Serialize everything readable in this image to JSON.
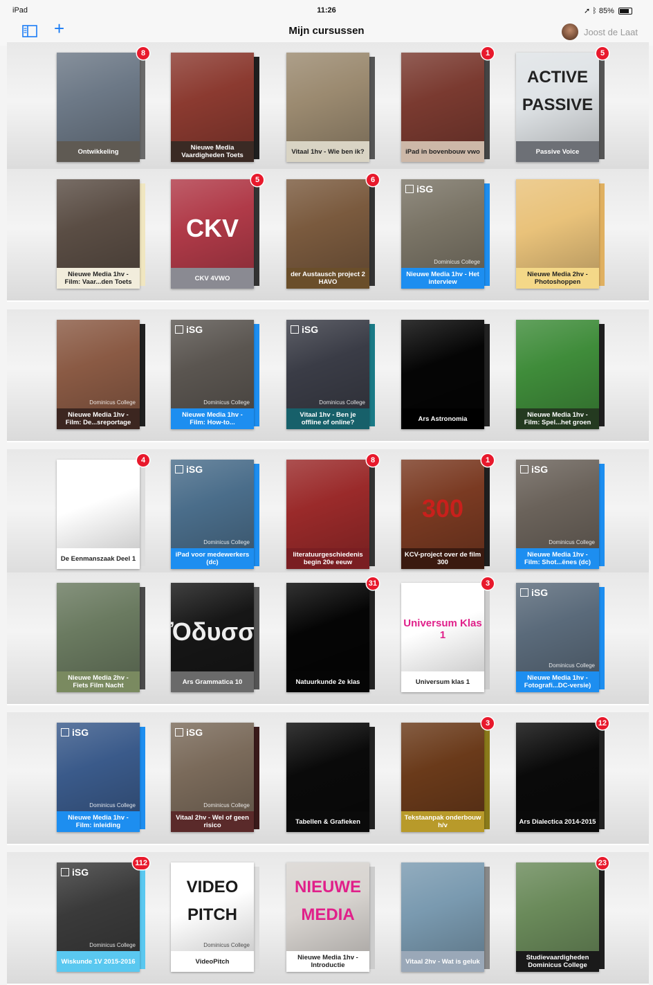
{
  "status": {
    "device": "iPad",
    "time": "11:26",
    "battery": "85%"
  },
  "nav": {
    "title": "Mijn cursussen",
    "user": "Joost de Laat"
  },
  "courses": [
    {
      "label": "Ontwikkeling",
      "badge": "8",
      "cover": "#6c7886",
      "band": "#5f5a53",
      "spine": "#6a6a6a"
    },
    {
      "label": "Nieuwe Media Vaardigheden Toets",
      "badge": "",
      "cover": "#8b3a30",
      "band": "#3a2a24",
      "spine": "#1f1f1f"
    },
    {
      "label": "Vitaal 1hv - Wie ben ik?",
      "badge": "",
      "cover": "#9b8a70",
      "band": "#d9d4c4",
      "spine": "#555555",
      "dark": true
    },
    {
      "label": "iPad in bovenbouw vwo",
      "badge": "1",
      "cover": "#7a3a30",
      "band": "#cdb8a8",
      "spine": "#444444",
      "dark": true
    },
    {
      "label": "Passive Voice",
      "badge": "5",
      "cover": "#dfe3e6",
      "band": "#6d7076",
      "spine": "#555555",
      "big": "ACTIVE|PASSIVE",
      "bigc": "#222"
    },
    {
      "label": "Nieuwe Media 1hv - Film: Vaar...den Toets",
      "badge": "",
      "cover": "#5a4d44",
      "band": "#f2eddc",
      "spine": "#f0e6c0",
      "dark": true
    },
    {
      "label": "CKV 4VWO",
      "badge": "5",
      "cover": "#b03a48",
      "band": "#8a8a92",
      "spine": "#333333",
      "big": "CKV",
      "bigc": "#fff"
    },
    {
      "label": "der Austausch project 2 HAVO",
      "badge": "6",
      "cover": "#7a5a3e",
      "band": "#6a4e2a",
      "spine": "#333333"
    },
    {
      "label": "Nieuwe Media 1hv - Het interview",
      "badge": "",
      "cover": "#7a7466",
      "band": "#1d8ef0",
      "spine": "#1d8ef0",
      "isg": "iSG",
      "school": "Dominicus College"
    },
    {
      "label": "Nieuwe Media 2hv - Photoshoppen",
      "badge": "",
      "cover": "#e9c27a",
      "band": "#f4d888",
      "spine": "#e0b060",
      "dark": true
    },
    {
      "label": "Nieuwe Media 1hv - Film: De...sreportage",
      "badge": "",
      "cover": "#8a5a44",
      "band": "#3c2620",
      "spine": "#1f1f1f",
      "school": "Dominicus College"
    },
    {
      "label": "Nieuwe Media 1hv - Film: How-to...",
      "badge": "",
      "cover": "#5a5550",
      "band": "#1d8ef0",
      "spine": "#1d8ef0",
      "isg": "iSG",
      "school": "Dominicus College"
    },
    {
      "label": "Vitaal 1hv - Ben je offline of online?",
      "badge": "",
      "cover": "#3a3c46",
      "band": "#17606a",
      "spine": "#1a7a86",
      "isg": "iSG",
      "school": "Dominicus College"
    },
    {
      "label": "Ars Astronomia",
      "badge": "",
      "cover": "#050505",
      "band": "#000000",
      "spine": "#222222"
    },
    {
      "label": "Nieuwe Media 1hv - Film: Spel...het groen",
      "badge": "",
      "cover": "#3f8c3a",
      "band": "#243a20",
      "spine": "#1f1f1f"
    },
    {
      "label": "De Eenmanszaak Deel 1",
      "badge": "4",
      "cover": "#ffffff",
      "band": "#ffffff",
      "spine": "#dddddd",
      "dark": true
    },
    {
      "label": "iPad voor medewerkers (dc)",
      "badge": "",
      "cover": "#4a6d8a",
      "band": "#1d8ef0",
      "spine": "#1d8ef0",
      "isg": "iSG",
      "school": "Dominicus College"
    },
    {
      "label": "literatuurgeschiedenis begin 20e eeuw",
      "badge": "8",
      "cover": "#9a2a2a",
      "band": "#7a1e22",
      "spine": "#333333"
    },
    {
      "label": "KCV-project over de film 300",
      "badge": "1",
      "cover": "#7a3a22",
      "band": "#3a1a10",
      "spine": "#1f1f1f",
      "big": "300",
      "bigc": "#c8201c"
    },
    {
      "label": "Nieuwe Media 1hv - Film: Shot...ënes (dc)",
      "badge": "",
      "cover": "#6a625a",
      "band": "#1d8ef0",
      "spine": "#1d8ef0",
      "isg": "iSG",
      "school": "Dominicus College"
    },
    {
      "label": "Nieuwe Media 2hv - Fiets Film Nacht",
      "badge": "",
      "cover": "#6a7a60",
      "band": "#7a8a60",
      "spine": "#4a4a4a"
    },
    {
      "label": "Ars Grammatica 10",
      "badge": "",
      "cover": "#161616",
      "band": "#6a6a6a",
      "spine": "#555555",
      "big": "Ὀδυσσεῦ",
      "bigc": "#eee"
    },
    {
      "label": "Natuurkunde 2e klas",
      "badge": "31",
      "cover": "#050505",
      "band": "#050505",
      "spine": "#222222"
    },
    {
      "label": "Universum klas 1",
      "badge": "3",
      "cover": "#ffffff",
      "band": "#ffffff",
      "spine": "#cccccc",
      "dark": true,
      "big": "Universum Klas 1",
      "bigc": "#e0208a"
    },
    {
      "label": "Nieuwe Media 1hv - Fotografi...DC-versie)",
      "badge": "",
      "cover": "#5a6a7a",
      "band": "#1d8ef0",
      "spine": "#1d8ef0",
      "isg": "iSG",
      "school": "Dominicus College"
    },
    {
      "label": "Nieuwe Media 1hv - Film: inleiding",
      "badge": "",
      "cover": "#3a5a8a",
      "band": "#1d8ef0",
      "spine": "#1d8ef0",
      "isg": "iSG",
      "school": "Dominicus College"
    },
    {
      "label": "Vitaal 2hv - Wel of geen risico",
      "badge": "",
      "cover": "#7a6a5a",
      "band": "#5a2a2a",
      "spine": "#3a1a1a",
      "isg": "iSG",
      "school": "Dominicus College"
    },
    {
      "label": "Tabellen & Grafieken",
      "badge": "",
      "cover": "#0a0a0a",
      "band": "#0a0a0a",
      "spine": "#222222"
    },
    {
      "label": "Tekstaanpak onderbouw h/v",
      "badge": "3",
      "cover": "#6a3a1a",
      "band": "#b89a2a",
      "spine": "#8a7a1a"
    },
    {
      "label": "Ars Dialectica 2014-2015",
      "badge": "12",
      "cover": "#0a0a0a",
      "band": "#0a0a0a",
      "spine": "#222222"
    },
    {
      "label": "Wiskunde 1V 2015-2016",
      "badge": "112",
      "cover": "#3a3a3a",
      "band": "#5ac8f0",
      "spine": "#5ac8f0",
      "isg": "iSG",
      "school": "Dominicus College"
    },
    {
      "label": "VideoPitch",
      "badge": "",
      "cover": "#ffffff",
      "band": "#ffffff",
      "spine": "#dddddd",
      "dark": true,
      "big": "VIDEO|PITCH",
      "bigc": "#1a1a1a",
      "school": "Dominicus College"
    },
    {
      "label": "Nieuwe Media 1hv - Introductie",
      "badge": "",
      "cover": "#d8d4d0",
      "band": "#ffffff",
      "spine": "#cccccc",
      "dark": true,
      "big": "NIEUWE|MEDIA",
      "bigc": "#e0208a"
    },
    {
      "label": "Vitaal 2hv - Wat is geluk",
      "badge": "",
      "cover": "#7a9ab0",
      "band": "#9aa8b8",
      "spine": "#888888"
    },
    {
      "label": "Studievaardigheden Dominicus College",
      "badge": "23",
      "cover": "#6a8a5a",
      "band": "#1a1a1a",
      "spine": "#1f1f1f"
    }
  ]
}
